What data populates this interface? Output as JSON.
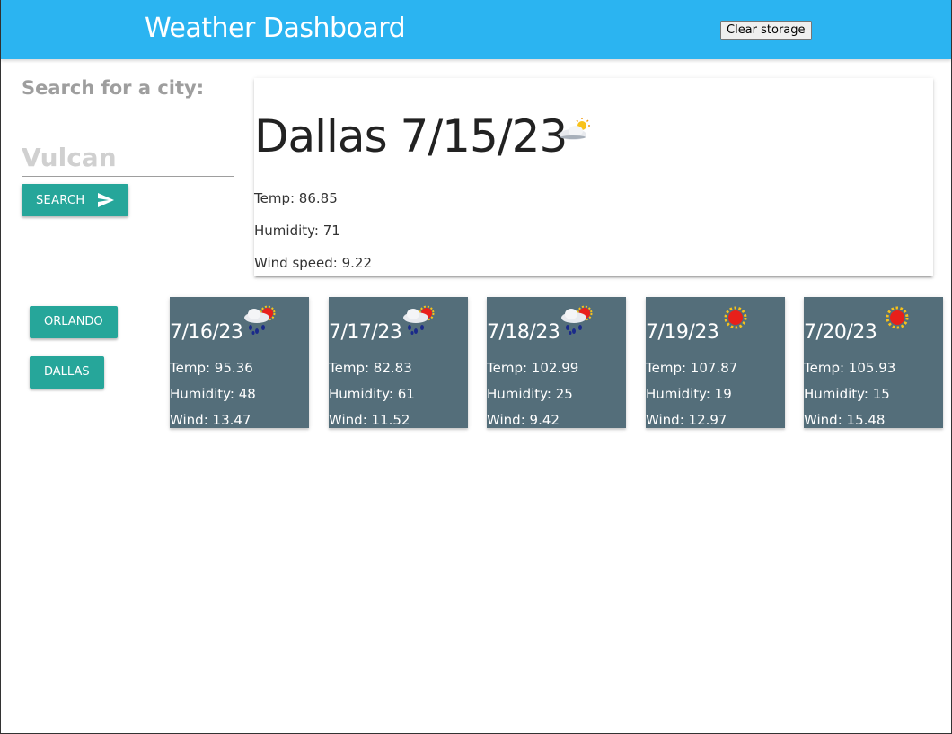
{
  "header": {
    "title": "Weather Dashboard",
    "clear_label": "Clear storage"
  },
  "search": {
    "label": "Search for a city:",
    "placeholder": "Vulcan",
    "button_label": "Search"
  },
  "history": [
    {
      "label": "Orlando"
    },
    {
      "label": "Dallas"
    }
  ],
  "current": {
    "title": "Dallas 7/15/23",
    "icon": "partly-cloudy-icon",
    "temp": "Temp: 86.85",
    "humidity": "Humidity: 71",
    "wind": "Wind speed: 9.22"
  },
  "forecast": [
    {
      "date": "7/16/23",
      "icon": "rain-sun-icon",
      "temp": "Temp: 95.36",
      "humidity": "Humidity: 48",
      "wind": "Wind: 13.47"
    },
    {
      "date": "7/17/23",
      "icon": "rain-sun-icon",
      "temp": "Temp: 82.83",
      "humidity": "Humidity: 61",
      "wind": "Wind: 11.52"
    },
    {
      "date": "7/18/23",
      "icon": "rain-sun-icon",
      "temp": "Temp: 102.99",
      "humidity": "Humidity: 25",
      "wind": "Wind: 9.42"
    },
    {
      "date": "7/19/23",
      "icon": "sun-icon",
      "temp": "Temp: 107.87",
      "humidity": "Humidity: 19",
      "wind": "Wind: 12.97"
    },
    {
      "date": "7/20/23",
      "icon": "sun-icon",
      "temp": "Temp: 105.93",
      "humidity": "Humidity: 15",
      "wind": "Wind: 15.48"
    }
  ],
  "colors": {
    "header": "#2bb4f1",
    "button": "#26a69a",
    "forecast_card": "#546e7a"
  }
}
